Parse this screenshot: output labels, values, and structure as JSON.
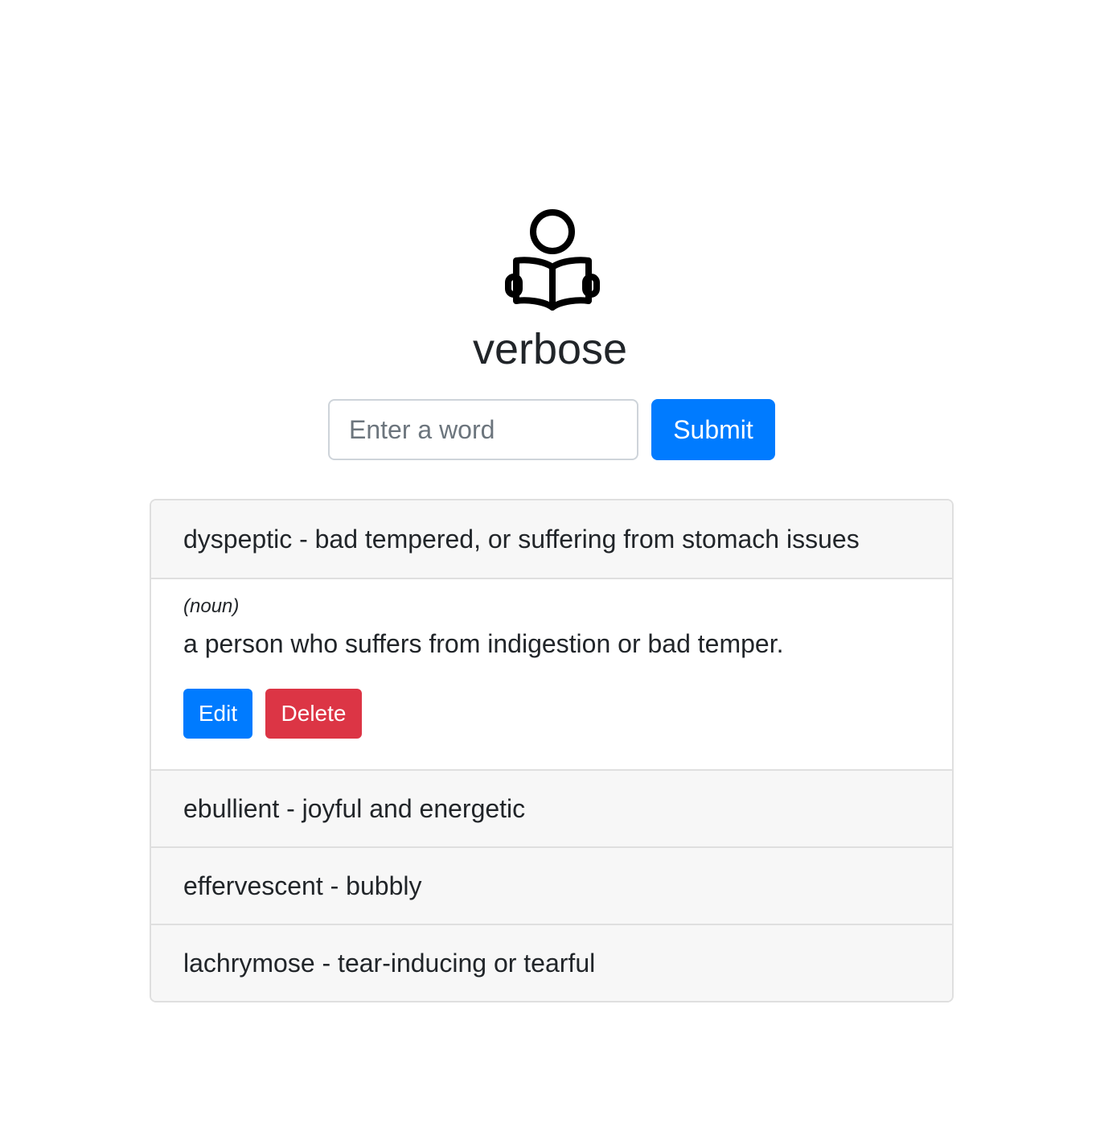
{
  "app": {
    "title": "verbose",
    "logo_icon": "person-reading-book-icon"
  },
  "search": {
    "placeholder": "Enter a word",
    "value": "",
    "submit_label": "Submit"
  },
  "colors": {
    "primary": "#007bff",
    "danger": "#dc3545",
    "header_bg": "#f7f7f7"
  },
  "entries": [
    {
      "header": "dyspeptic - bad tempered, or suffering from stomach issues",
      "expanded": true,
      "part_of_speech": "(noun)",
      "definition": "a person who suffers from indigestion or bad temper.",
      "edit_label": "Edit",
      "delete_label": "Delete"
    },
    {
      "header": "ebullient - joyful and energetic",
      "expanded": false
    },
    {
      "header": "effervescent - bubbly",
      "expanded": false
    },
    {
      "header": "lachrymose - tear-inducing or tearful",
      "expanded": false
    }
  ]
}
